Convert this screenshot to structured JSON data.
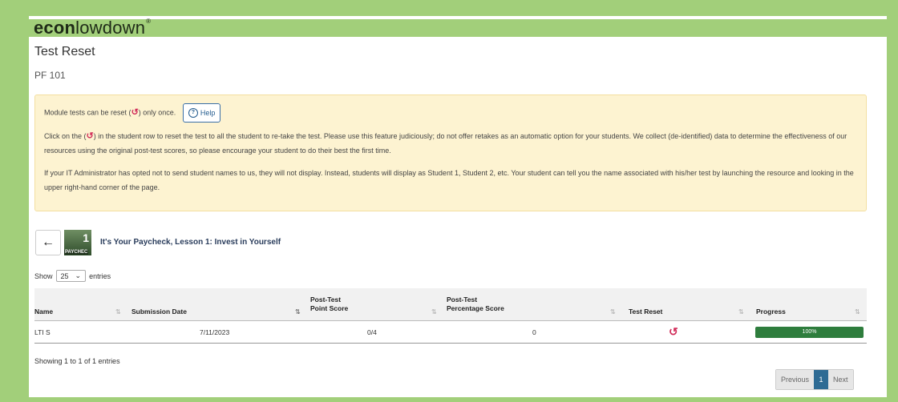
{
  "brand": {
    "bold": "econ",
    "thin": "lowdown",
    "mark": "®"
  },
  "page": {
    "title": "Test Reset",
    "subtitle": "PF 101"
  },
  "notice": {
    "line1_prefix": "Module tests can be reset (",
    "line1_suffix": ") only once.",
    "help_label": "Help",
    "para1_prefix": "Click on the (",
    "para1_body": ") in the student row to reset the test to all the student to re-take the test. Please use this feature judiciously; do not offer retakes as an automatic option for your students. We collect (de-identified) data to determine the effectiveness of our resources using the original post-test scores, so please encourage your student to do their best the first time.",
    "para2": "If your IT Administrator has opted not to send student names to us, they will not display. Instead, students will display as Student 1, Student 2, etc. Your student can tell you the name associated with his/her test by launching the resource and looking in the upper right-hand corner of the page."
  },
  "lesson": {
    "title": "It's Your Paycheck, Lesson 1: Invest in Yourself",
    "thumb_number": "1",
    "thumb_caption": "PAYCHEC"
  },
  "table": {
    "show_label": "Show",
    "entries_value": "25",
    "entries_label": "entries",
    "headers": {
      "name": "Name",
      "submission_date": "Submission Date",
      "post_test": "Post-Test",
      "point_score": "Point Score",
      "percentage_score": "Percentage Score",
      "test_reset": "Test Reset",
      "progress": "Progress"
    },
    "rows": [
      {
        "name": "LTI S",
        "date": "7/11/2023",
        "point_score": "0/4",
        "percentage_score": "0",
        "progress": "100%"
      }
    ],
    "info": "Showing 1 to 1 of 1 entries"
  },
  "pager": {
    "previous": "Previous",
    "current": "1",
    "next": "Next"
  },
  "icons": {
    "back": "arrow-left-icon",
    "reset": "history-icon",
    "help": "question-circle-icon",
    "sort": "sort-icon",
    "dropdown": "chevron-down-icon"
  },
  "colors": {
    "brand_green": "#a2cf7a",
    "reset_red": "#d12d5a",
    "progress_green": "#2e7d3d",
    "pager_active": "#2e6b94",
    "notice_bg": "#fdf3d1"
  }
}
